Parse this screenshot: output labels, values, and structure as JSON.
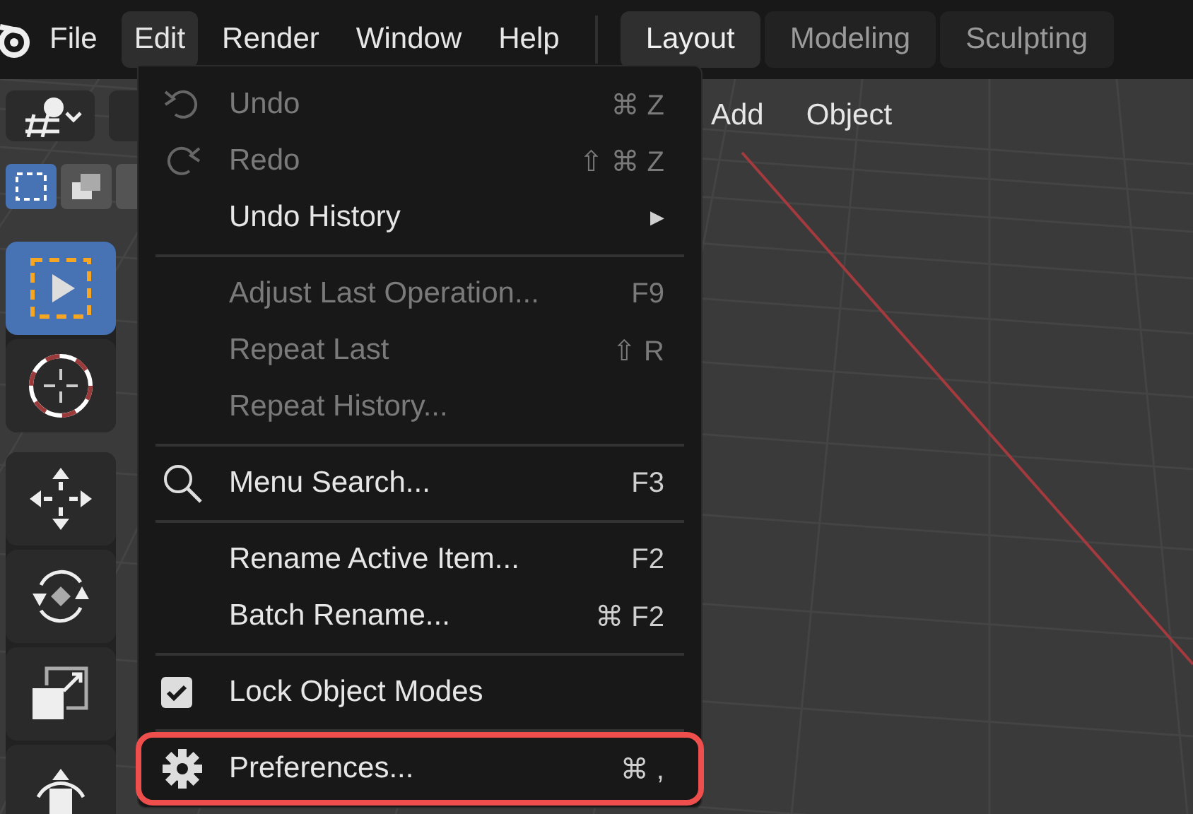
{
  "menubar": {
    "items": [
      {
        "label": "File",
        "selected": false
      },
      {
        "label": "Edit",
        "selected": true
      },
      {
        "label": "Render",
        "selected": false
      },
      {
        "label": "Window",
        "selected": false
      },
      {
        "label": "Help",
        "selected": false
      }
    ]
  },
  "workspace_tabs": [
    {
      "label": "Layout",
      "selected": true
    },
    {
      "label": "Modeling",
      "selected": false
    },
    {
      "label": "Sculpting",
      "selected": false
    }
  ],
  "viewport_header": {
    "menus": [
      "Add",
      "Object"
    ]
  },
  "select_modes": [
    {
      "selected": true
    },
    {
      "selected": false
    },
    {
      "selected": false
    }
  ],
  "toolbar": {
    "groups": [
      [
        {
          "selected": true
        },
        {
          "selected": false
        }
      ],
      [
        {
          "selected": false
        },
        {
          "selected": false
        },
        {
          "selected": false
        },
        {
          "selected": false
        }
      ]
    ]
  },
  "edit_menu": {
    "groups": [
      [
        {
          "kind": "command",
          "label": "Undo",
          "shortcut": "⌘ Z",
          "disabled": true
        },
        {
          "kind": "command",
          "label": "Redo",
          "shortcut": "⇧ ⌘ Z",
          "disabled": true
        },
        {
          "kind": "submenu",
          "label": "Undo History",
          "submenu_mark": "▶",
          "disabled": false
        }
      ],
      [
        {
          "kind": "command",
          "label": "Adjust Last Operation...",
          "shortcut": "F9",
          "disabled": true
        },
        {
          "kind": "command",
          "label": "Repeat Last",
          "shortcut": "⇧ R",
          "disabled": true
        },
        {
          "kind": "command",
          "label": "Repeat History...",
          "disabled": true
        }
      ],
      [
        {
          "kind": "command",
          "label": "Menu Search...",
          "shortcut": "F3",
          "disabled": false
        }
      ],
      [
        {
          "kind": "command",
          "label": "Rename Active Item...",
          "shortcut": "F2",
          "disabled": false
        },
        {
          "kind": "command",
          "label": "Batch Rename...",
          "shortcut": "⌘ F2",
          "disabled": false
        }
      ],
      [
        {
          "kind": "toggle",
          "label": "Lock Object Modes",
          "checked": true,
          "disabled": false
        }
      ],
      [
        {
          "kind": "command",
          "label": "Preferences...",
          "shortcut": "⌘ ,",
          "disabled": false,
          "highlighted": true
        }
      ]
    ]
  }
}
